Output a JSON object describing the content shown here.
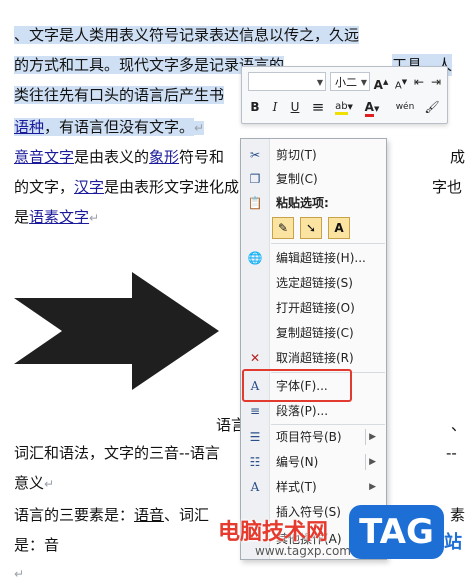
{
  "doc": {
    "p1_l1": "、文字是人类用表义符号记录表达信息以传之，久远",
    "p1_l2": "的方式和工具。现代文字多是记录语言的",
    "p1_l2_end": "工具。人",
    "p1_l3": "类往往先有口头的语言后产生书",
    "p1_l4_link": "语种",
    "p1_l4_rest": "，有语言但没有文字。",
    "p2_l1_link1": "意音文字",
    "p2_l1_mid": "是由表义的",
    "p2_l1_link2": "象形",
    "p2_l1_rest": "符号和",
    "p2_l1_end": "成",
    "p2_l2_a": "的文字，",
    "p2_l2_link": "汉字",
    "p2_l2_b": "是由表形文字进化成",
    "p2_l2_end": "字也",
    "p2_l3_a": "是",
    "p2_l3_link": "语素文字",
    "p3_l1_a": "语言",
    "p3_l1_end": "、",
    "p3_l2_a": "词汇和语法，文字的三音--语言",
    "p3_l2_end": "--",
    "p3_l3": "意义",
    "p4_l1_a": "语言的三要素是：",
    "p4_l1_u1": "语音",
    "p4_l1_b": "、词汇",
    "p4_l1_end": "素",
    "p4_l2": "是：音"
  },
  "mini_toolbar": {
    "font_name": "",
    "font_size": "小二",
    "grow": "A",
    "shrink": "A",
    "bold": "B",
    "italic": "I",
    "underline": "U",
    "center": "≡",
    "highlight": "ab",
    "font_color": "A",
    "phonetic": "wén"
  },
  "menu": {
    "items": [
      {
        "label": "剪切(T)",
        "icon": "scissors-icon"
      },
      {
        "label": "复制(C)",
        "icon": "copy-icon"
      },
      {
        "label": "编辑超链接(H)...",
        "icon": "edit-link-icon"
      },
      {
        "label": "选定超链接(S)",
        "icon": ""
      },
      {
        "label": "打开超链接(O)",
        "icon": ""
      },
      {
        "label": "复制超链接(C)",
        "icon": ""
      },
      {
        "label": "取消超链接(R)",
        "icon": "remove-link-icon"
      },
      {
        "label": "字体(F)...",
        "icon": "font-icon"
      },
      {
        "label": "段落(P)...",
        "icon": "paragraph-icon"
      },
      {
        "label": "项目符号(B)",
        "icon": "bullets-icon"
      },
      {
        "label": "编号(N)",
        "icon": "numbering-icon"
      },
      {
        "label": "样式(T)",
        "icon": "styles-icon"
      },
      {
        "label": "插入符号(S)",
        "icon": ""
      },
      {
        "label": "其他操作(A)",
        "icon": ""
      }
    ],
    "paste_header": "粘贴选项:",
    "paste_text_option": "A"
  },
  "watermark": {
    "site_name": "电脑技术网",
    "url": "www.tagxp.com",
    "logo": "TAG",
    "suffix": "站"
  },
  "colors": {
    "selection": "#cfe0f5",
    "link": "#1a1a9a",
    "highlight_box": "#e23a2f",
    "logo_blue": "#1d6fd6"
  }
}
